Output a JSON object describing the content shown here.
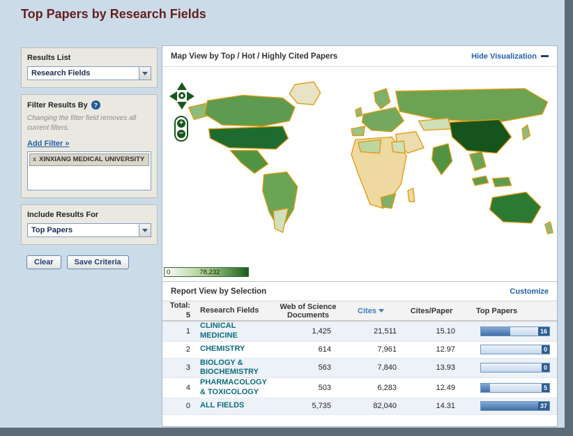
{
  "page": {
    "title": "Top Papers by Research Fields"
  },
  "sidebar": {
    "results_list_label": "Results List",
    "results_list_value": "Research Fields",
    "filter_label": "Filter Results By",
    "filter_help": "?",
    "filter_note": "Changing the filter field removes all current filters.",
    "add_filter_link": "Add Filter »",
    "active_filter": {
      "remove_icon": "x",
      "name": "XINXIANG MEDICAL UNIVERSITY"
    },
    "include_label": "Include Results For",
    "include_value": "Top Papers",
    "clear_button": "Clear",
    "save_button": "Save Criteria"
  },
  "map_panel": {
    "title": "Map View by Top / Hot / Highly Cited Papers",
    "hide_link": "Hide Visualization",
    "zoom_in": "+",
    "zoom_out": "−",
    "legend_min": "0",
    "legend_max": "78,232"
  },
  "report": {
    "title": "Report View by Selection",
    "customize_link": "Customize",
    "total_label": "Total:",
    "total_value": "5",
    "bar_max": 37,
    "columns": {
      "fields": "Research Fields",
      "docs_line1": "Web of Science",
      "docs_line2": "Documents",
      "cites": "Cites",
      "cites_per_paper": "Cites/Paper",
      "top_papers": "Top Papers"
    },
    "rows": [
      {
        "rank": "1",
        "field": "CLINICAL MEDICINE",
        "docs": "1,425",
        "cites": "21,511",
        "cpp": "15.10",
        "top_papers": 16,
        "top_papers_label": "16"
      },
      {
        "rank": "2",
        "field": "CHEMISTRY",
        "docs": "614",
        "cites": "7,961",
        "cpp": "12.97",
        "top_papers": 0,
        "top_papers_label": "0"
      },
      {
        "rank": "3",
        "field": "BIOLOGY & BIOCHEMISTRY",
        "docs": "563",
        "cites": "7,840",
        "cpp": "13.93",
        "top_papers": 0,
        "top_papers_label": "0"
      },
      {
        "rank": "4",
        "field": "PHARMACOLOGY & TOXICOLOGY",
        "docs": "503",
        "cites": "6,283",
        "cpp": "12.49",
        "top_papers": 5,
        "top_papers_label": "5"
      },
      {
        "rank": "0",
        "field": "ALL FIELDS",
        "docs": "5,735",
        "cites": "82,040",
        "cpp": "14.31",
        "top_papers": 37,
        "top_papers_label": "37"
      }
    ]
  }
}
